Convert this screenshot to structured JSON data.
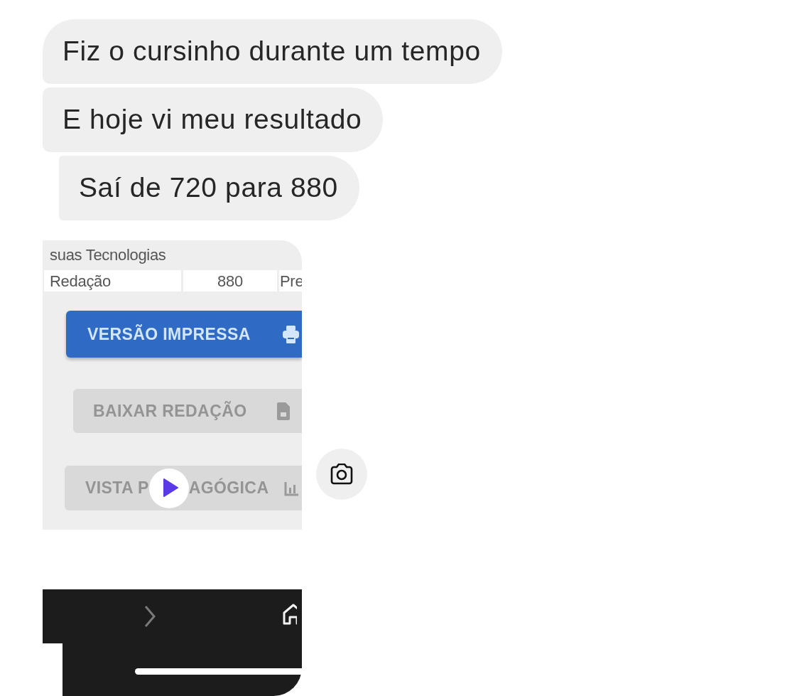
{
  "messages": [
    {
      "text": "Fiz o cursinho durante um tempo"
    },
    {
      "text": "E hoje vi meu resultado"
    },
    {
      "text": "Saí de 720 para 880"
    }
  ],
  "attachment": {
    "rows": [
      {
        "shaded": true,
        "cells": [
          "suas Tecnologias"
        ]
      },
      {
        "shaded": false,
        "cells": [
          "Redação",
          "880",
          "Pre"
        ]
      }
    ],
    "buttons": [
      {
        "label_parts": [
          "VERSÃO IMPRESSA"
        ],
        "disabled": false
      },
      {
        "label_parts": [
          "BAIXAR REDAÇÃO"
        ],
        "disabled": true
      },
      {
        "label_parts": [
          "VISTA P",
          "AGÓGICA"
        ],
        "disabled": true
      }
    ]
  }
}
